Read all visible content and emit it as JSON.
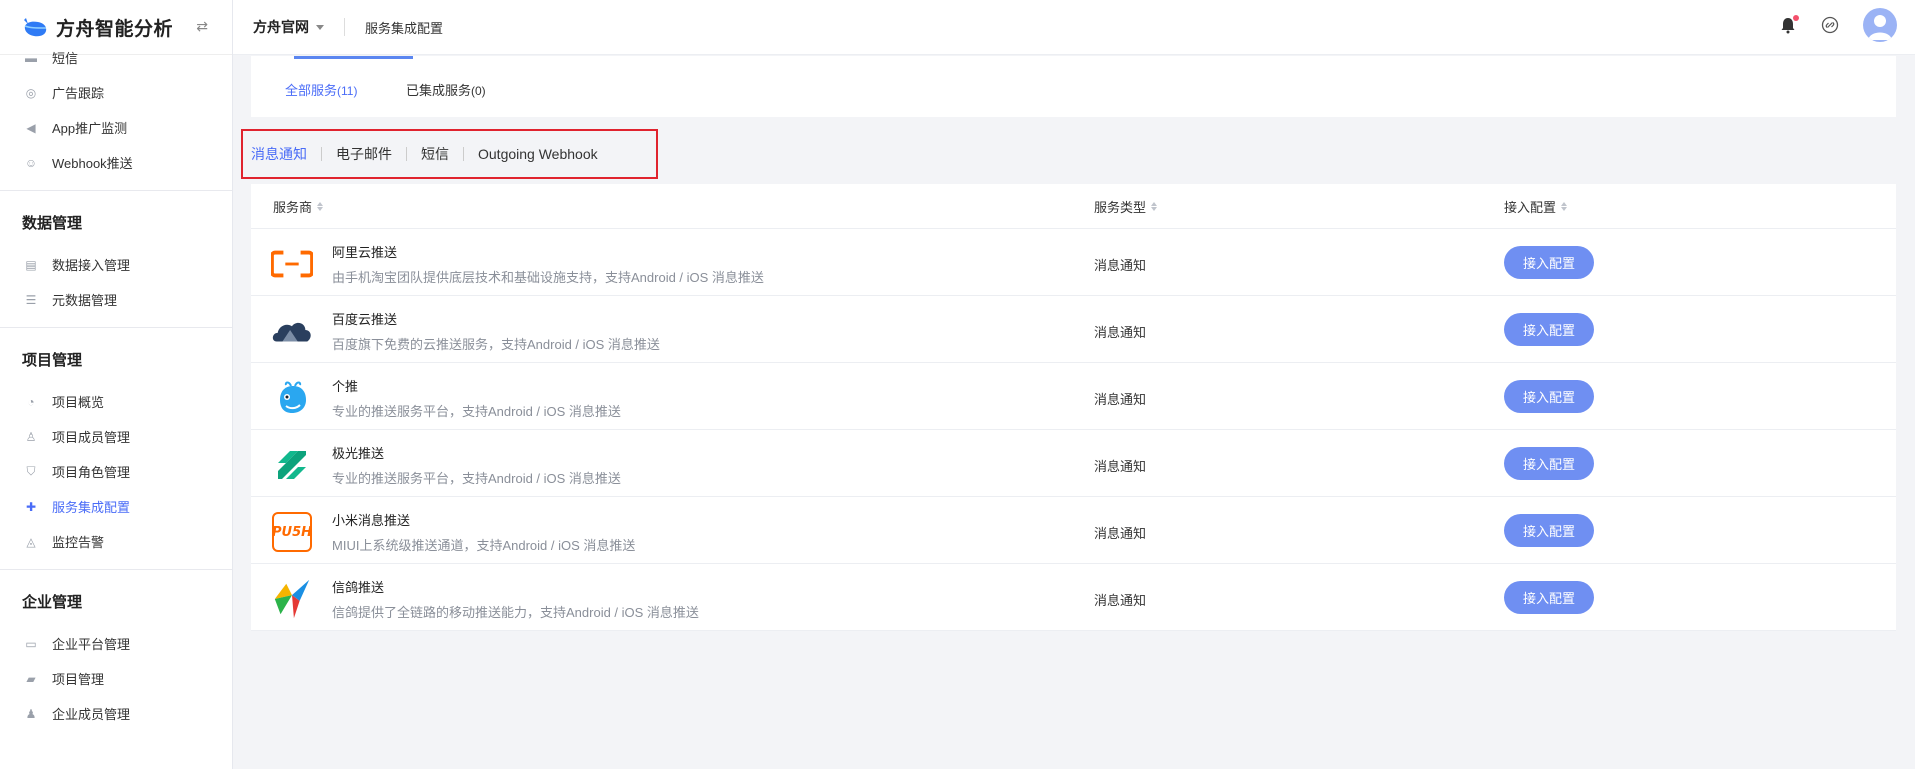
{
  "app": {
    "title": "方舟智能分析"
  },
  "sidebar": {
    "items_top": [
      {
        "label": "短信",
        "icon": "sms-icon"
      },
      {
        "label": "广告跟踪",
        "icon": "target-icon"
      },
      {
        "label": "App推广监测",
        "icon": "megaphone-icon"
      },
      {
        "label": "Webhook推送",
        "icon": "robot-icon"
      }
    ],
    "groups": [
      {
        "title": "数据管理",
        "items": [
          {
            "label": "数据接入管理",
            "icon": "database-icon"
          },
          {
            "label": "元数据管理",
            "icon": "metadata-icon"
          }
        ]
      },
      {
        "title": "项目管理",
        "items": [
          {
            "label": "项目概览",
            "icon": "dashboard-icon"
          },
          {
            "label": "项目成员管理",
            "icon": "user-icon"
          },
          {
            "label": "项目角色管理",
            "icon": "shield-icon"
          },
          {
            "label": "服务集成配置",
            "icon": "puzzle-icon",
            "active": true
          },
          {
            "label": "监控告警",
            "icon": "alarm-icon"
          }
        ]
      },
      {
        "title": "企业管理",
        "items": [
          {
            "label": "企业平台管理",
            "icon": "monitor-icon"
          },
          {
            "label": "项目管理",
            "icon": "folder-icon"
          },
          {
            "label": "企业成员管理",
            "icon": "users-icon"
          }
        ]
      }
    ]
  },
  "header": {
    "project": "方舟官网",
    "breadcrumb": "服务集成配置"
  },
  "tabs": [
    {
      "label": "全部服务",
      "count": "(11)",
      "active": true
    },
    {
      "label": "已集成服务",
      "count": "(0)",
      "active": false
    }
  ],
  "filters": [
    "消息通知",
    "电子邮件",
    "短信",
    "Outgoing Webhook"
  ],
  "table": {
    "columns": [
      "服务商",
      "服务类型",
      "接入配置"
    ],
    "rows": [
      {
        "name": "阿里云推送",
        "desc": "由手机淘宝团队提供底层技术和基础设施支持，支持Android / iOS 消息推送",
        "type": "消息通知",
        "action": "接入配置",
        "logo": "aliyun-logo"
      },
      {
        "name": "百度云推送",
        "desc": "百度旗下免费的云推送服务，支持Android / iOS 消息推送",
        "type": "消息通知",
        "action": "接入配置",
        "logo": "baidu-cloud-logo"
      },
      {
        "name": "个推",
        "desc": "专业的推送服务平台，支持Android / iOS 消息推送",
        "type": "消息通知",
        "action": "接入配置",
        "logo": "getui-logo"
      },
      {
        "name": "极光推送",
        "desc": "专业的推送服务平台，支持Android / iOS 消息推送",
        "type": "消息通知",
        "action": "接入配置",
        "logo": "jpush-logo"
      },
      {
        "name": "小米消息推送",
        "desc": "MIUI上系统级推送通道，支持Android / iOS 消息推送",
        "type": "消息通知",
        "action": "接入配置",
        "logo": "xiaomi-push-logo",
        "logo_text": "PU5H"
      },
      {
        "name": "信鸽推送",
        "desc": "信鸽提供了全链路的移动推送能力，支持Android / iOS 消息推送",
        "type": "消息通知",
        "action": "接入配置",
        "logo": "xinge-logo"
      }
    ]
  },
  "colors": {
    "accent": "#4a6cf7",
    "button": "#6f8ff2",
    "highlight_border": "#e0232e",
    "notification_dot": "#f4516c"
  }
}
